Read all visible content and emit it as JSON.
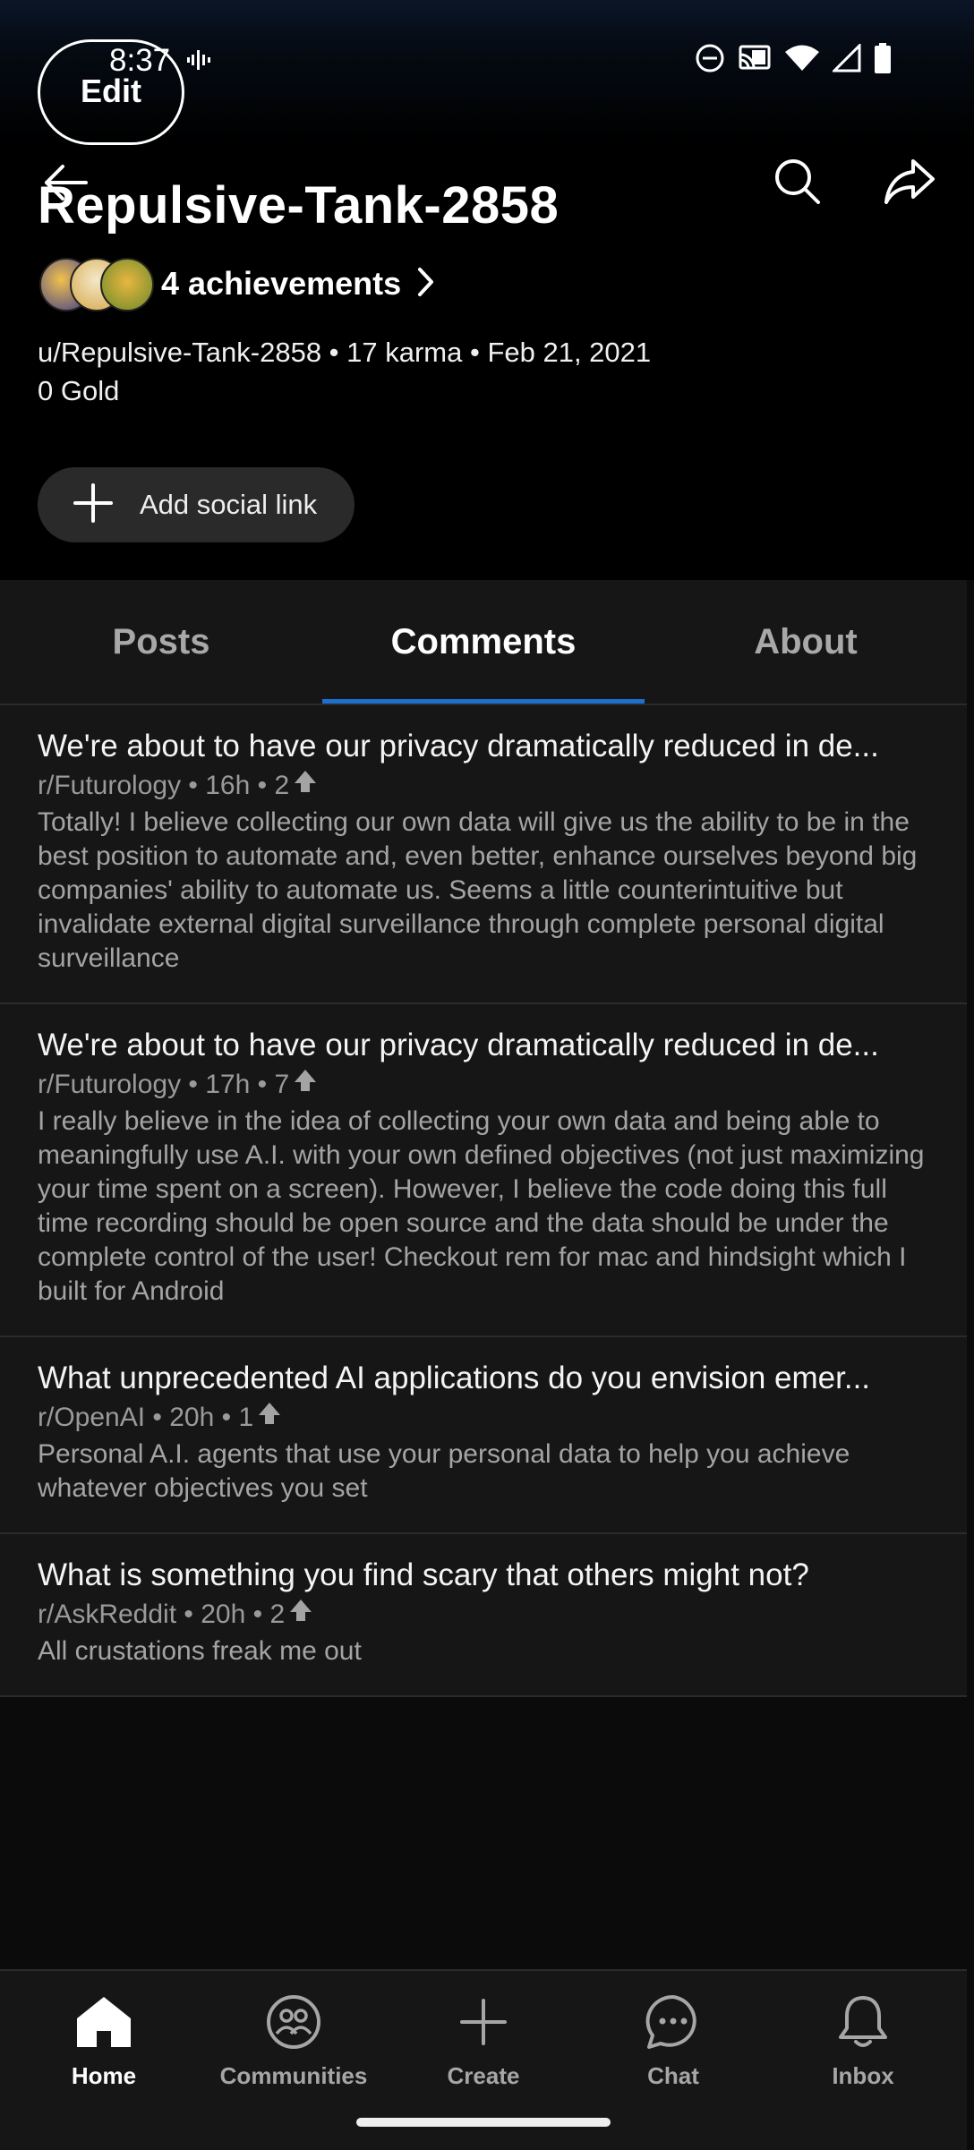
{
  "status_bar": {
    "time": "8:37",
    "icons": [
      "vibrate-icon",
      "do-not-disturb-icon",
      "cast-icon",
      "wifi-icon",
      "cell-signal-icon",
      "battery-icon"
    ]
  },
  "header": {
    "edit_label": "Edit",
    "username": "Repulsive-Tank-2858",
    "achievements_label": "4 achievements",
    "meta_line": "u/Repulsive-Tank-2858 • 17 karma • Feb 21, 2021",
    "gold_line": "0 Gold",
    "social_button_label": "Add social link"
  },
  "tabs": [
    {
      "label": "Posts",
      "active": false
    },
    {
      "label": "Comments",
      "active": true
    },
    {
      "label": "About",
      "active": false
    }
  ],
  "comments": [
    {
      "title": "We're about to have our privacy dramatically reduced in de...",
      "meta": "r/Futurology • 16h • 2",
      "body": "Totally! I believe collecting our own data will give us the ability to be in the best position to automate and, even better, enhance ourselves beyond big companies' ability to automate us. Seems a little counterintuitive but invalidate external digital surveillance through complete personal digital surveillance"
    },
    {
      "title": "We're about to have our privacy dramatically reduced in de...",
      "meta": "r/Futurology • 17h • 7",
      "body": "I really believe in the idea of collecting your own data and being able to meaningfully use A.I. with your own defined objectives (not just maximizing your time spent on a screen). However, I believe the code doing this full time recording should be open source and the data should be under the complete control of the user!  Checkout rem for mac and hindsight which I built for Android"
    },
    {
      "title": "What unprecedented AI applications do you envision emer...",
      "meta": "r/OpenAI • 20h • 1",
      "body": "Personal A.I. agents that use your personal data to help you achieve whatever objectives you set"
    },
    {
      "title": "What is something you find scary that others might not?",
      "meta": "r/AskReddit • 20h • 2",
      "body": "All crustations freak me out"
    }
  ],
  "bottom_nav": [
    {
      "label": "Home",
      "icon": "home-icon",
      "active": true
    },
    {
      "label": "Communities",
      "icon": "communities-icon",
      "active": false
    },
    {
      "label": "Create",
      "icon": "plus-icon",
      "active": false
    },
    {
      "label": "Chat",
      "icon": "chat-icon",
      "active": false
    },
    {
      "label": "Inbox",
      "icon": "bell-icon",
      "active": false
    }
  ],
  "colors": {
    "accent": "#1f6fd1",
    "background": "#000000",
    "card": "#161616"
  }
}
